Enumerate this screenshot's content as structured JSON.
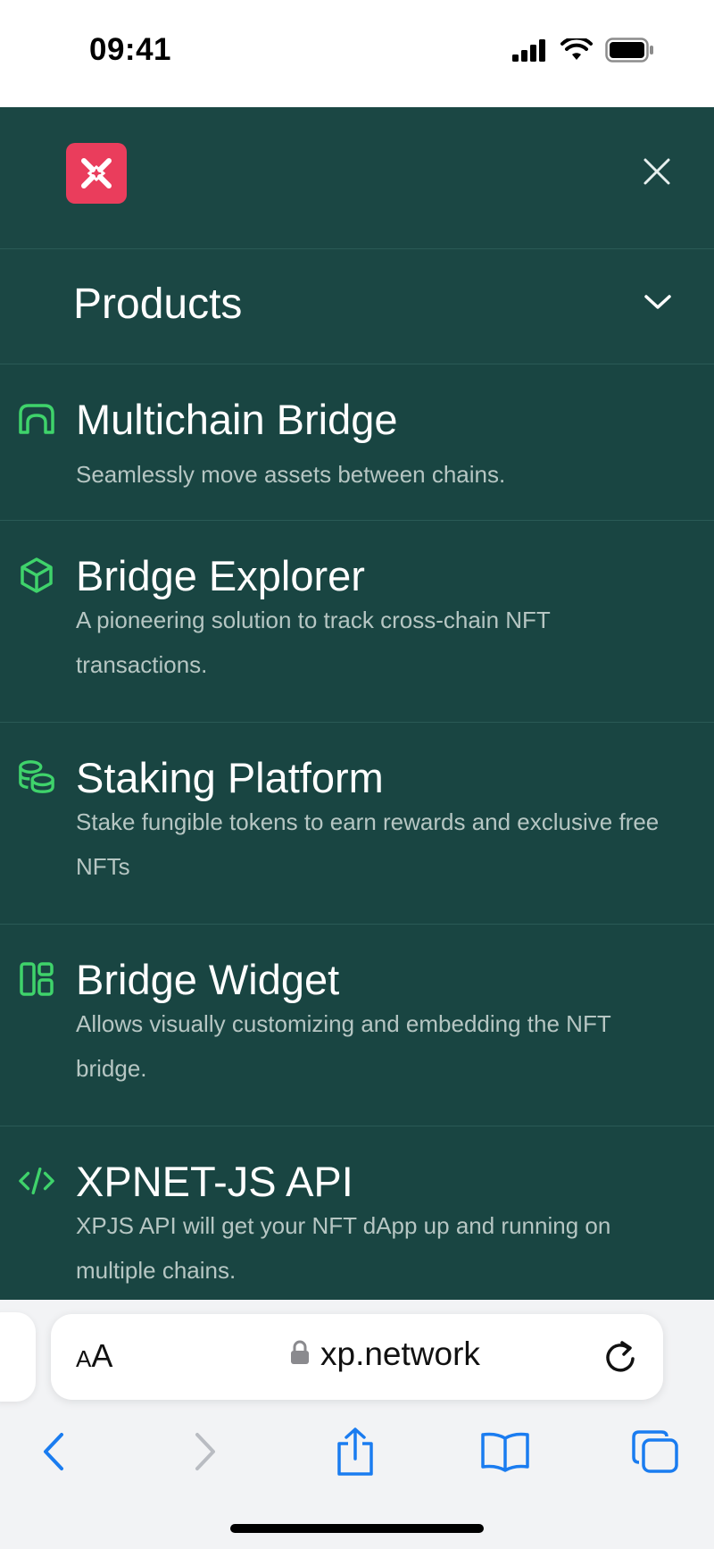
{
  "status_bar": {
    "time": "09:41"
  },
  "menu": {
    "products_label": "Products",
    "items": [
      {
        "title": "Multichain Bridge",
        "description": "Seamlessly move assets between chains.",
        "icon": "bridge-icon"
      },
      {
        "title": "Bridge Explorer",
        "description": "A pioneering solution to track cross-chain NFT transactions.",
        "icon": "cube-icon"
      },
      {
        "title": "Staking Platform",
        "description": "Stake fungible tokens to earn rewards and exclusive free NFTs",
        "icon": "coins-icon"
      },
      {
        "title": "Bridge Widget",
        "description": "Allows visually customizing and embedding the NFT bridge.",
        "icon": "layout-icon"
      },
      {
        "title": "XPNET-JS API",
        "description": "XPJS API will get your NFT dApp up and running on multiple chains.",
        "icon": "code-icon"
      }
    ]
  },
  "browser": {
    "aa_small": "A",
    "aa_big": "A",
    "url": "xp.network"
  },
  "colors": {
    "menu_bg": "#194542",
    "accent_green": "#3fd36b",
    "logo_red": "#ea3d5c",
    "safari_blue": "#1a7cf0"
  }
}
